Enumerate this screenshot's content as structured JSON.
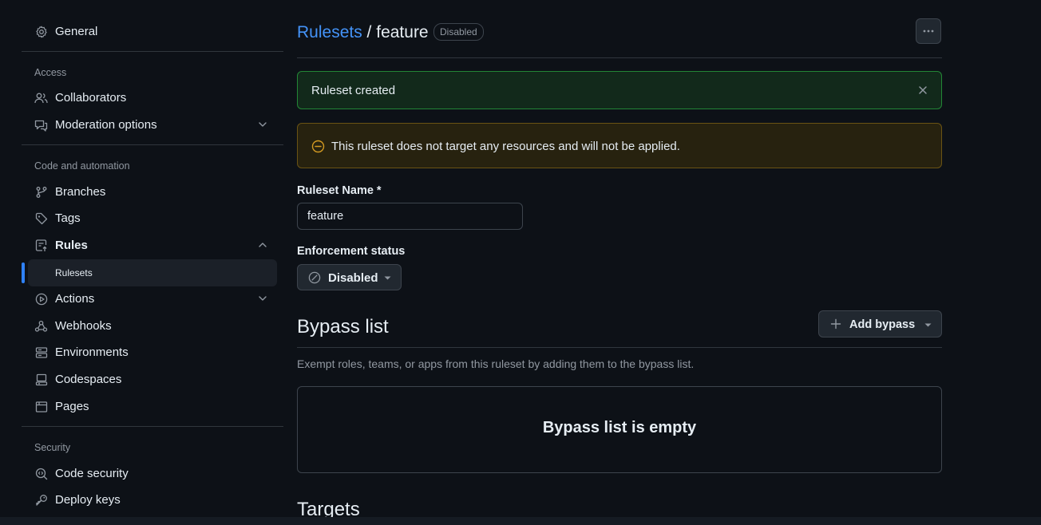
{
  "sidebar": {
    "general": {
      "label": "General",
      "icon": "gear-icon"
    },
    "sections": {
      "access": {
        "title": "Access"
      },
      "code": {
        "title": "Code and automation"
      },
      "security": {
        "title": "Security"
      }
    },
    "items": {
      "collaborators": {
        "label": "Collaborators",
        "icon": "people-icon"
      },
      "moderation": {
        "label": "Moderation options",
        "icon": "report-icon"
      },
      "branches": {
        "label": "Branches",
        "icon": "git-branch-icon"
      },
      "tags": {
        "label": "Tags",
        "icon": "tag-icon"
      },
      "rules": {
        "label": "Rules",
        "icon": "rules-icon"
      },
      "rulesets": {
        "label": "Rulesets"
      },
      "actions": {
        "label": "Actions",
        "icon": "play-icon"
      },
      "webhooks": {
        "label": "Webhooks",
        "icon": "webhook-icon"
      },
      "environments": {
        "label": "Environments",
        "icon": "server-icon"
      },
      "codespaces": {
        "label": "Codespaces",
        "icon": "codespaces-icon"
      },
      "pages": {
        "label": "Pages",
        "icon": "browser-icon"
      },
      "code_security": {
        "label": "Code security",
        "icon": "codescan-icon"
      },
      "deploy_keys": {
        "label": "Deploy keys",
        "icon": "key-icon"
      }
    }
  },
  "header": {
    "breadcrumb_link": "Rulesets",
    "separator": "/",
    "ruleset_name": "feature",
    "status_badge": "Disabled"
  },
  "flash_success": {
    "message": "Ruleset created"
  },
  "flash_warning": {
    "message": "This ruleset does not target any resources and will not be applied."
  },
  "form": {
    "name_label": "Ruleset Name *",
    "name_value": "feature",
    "enforcement_label": "Enforcement status",
    "enforcement_value": "Disabled"
  },
  "bypass": {
    "heading": "Bypass list",
    "add_button": "Add bypass",
    "description": "Exempt roles, teams, or apps from this ruleset by adding them to the bypass list.",
    "empty_message": "Bypass list is empty"
  },
  "targets": {
    "heading": "Targets"
  },
  "colors": {
    "background": "#0d1117",
    "link": "#4493f8",
    "accent": "#2f81f7",
    "success_border": "#238636",
    "warning_border": "#6a5314",
    "muted_text": "#9198a1"
  }
}
